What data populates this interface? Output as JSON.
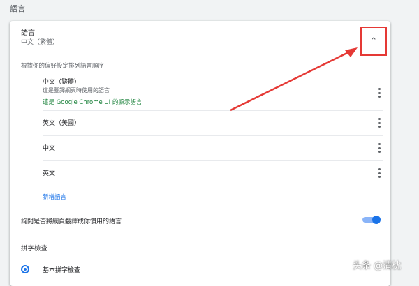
{
  "section_title": "語言",
  "header": {
    "label": "語言",
    "value": "中文（繁體）",
    "collapse_icon": "chevron-up-icon"
  },
  "order_label": "根據你的偏好設定排列語言順序",
  "languages": [
    {
      "name": "中文（繁體）",
      "sub": "這是翻譯網頁時使用的語言",
      "ui_note": "這是 Google Chrome UI 的顯示語言"
    },
    {
      "name": "英文（美國）"
    },
    {
      "name": "中文"
    },
    {
      "name": "英文"
    }
  ],
  "add_language": "新增語言",
  "translate_offer": {
    "label": "詢問是否將網頁翻譯成你慣用的語言",
    "enabled": true
  },
  "spell_check": {
    "title": "拼字檢查",
    "option_basic": "基本拼字檢查",
    "selected": true
  },
  "annotation_color": "#e53935",
  "accent_color": "#1a73e8",
  "watermark": "头条 @清枕"
}
